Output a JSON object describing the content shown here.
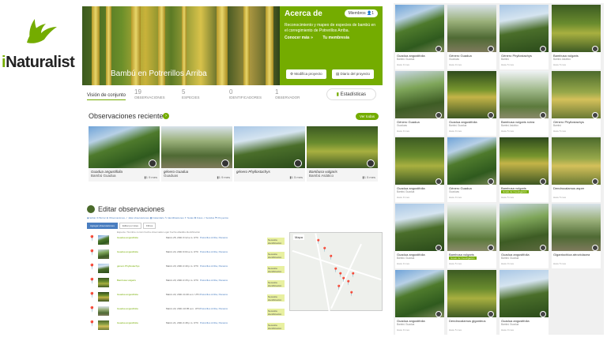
{
  "logo": {
    "text_i": "i",
    "text_rest": "Naturalist",
    "brand_color": "#74ac00"
  },
  "project": {
    "title": "Bambú en Potrerillos Arriba",
    "about_title": "Acerca de",
    "member_label": "Miembros",
    "member_count": "1",
    "description": "Reconocimiento y mapeo de especies de bambú en el corregimiento de Potrerillos Arriba.",
    "read_more": "Conocer más »",
    "membership": "Tu membresía",
    "modify_btn": "Modifica proyecto",
    "journal_btn": "Diario del proyecto"
  },
  "stats": {
    "tab": "Visión de conjunto",
    "observations_num": "19",
    "observations_lbl": "Observaciones",
    "species_num": "5",
    "species_lbl": "Especies",
    "identifiers_num": "0",
    "identifiers_lbl": "Identificadores",
    "observers_num": "1",
    "observers_lbl": "Observador",
    "stats_btn": "Estadísticas"
  },
  "recent": {
    "title": "Observaciones recientes",
    "view_all": "Ver todas",
    "cards": [
      {
        "name": "Guadua angustifolia",
        "common": "Bambú Guadua",
        "count": "1",
        "ago": "9 mes"
      },
      {
        "name": "género Guadua",
        "common": "Guaduas",
        "count": "1",
        "ago": "9 mes"
      },
      {
        "name": "género Phyllostachys",
        "common": "",
        "count": "1",
        "ago": "5 mes"
      },
      {
        "name": "Bambusa vulgaris",
        "common": "Bambú Asiático",
        "count": "1",
        "ago": "5 mes"
      }
    ]
  },
  "edit": {
    "title": "Editar observaciones",
    "toolbar": "◉ Editar   ⊘ Borrar   ⊕ Observaciones   ✓ Jalar observaciones   ▦ Calendario   ✎ Identificaciones   ✦ Notas   ✿ Fotos   ♫ Sonidos   ⚑ Proyectos",
    "filter_on": "Agregar observaciones",
    "filter_2": "Editar por lotes",
    "filter_3": "Filtros",
    "col_headers": "Especie / Nombre común          Fecha observada          Lugar                              Fecha añadida              Identificación",
    "map_label": "Mapa",
    "rows": [
      {
        "name": "Guadua angustifolia",
        "date": "Marzo 25, 2021 3:12 a.m. UTC",
        "loc": "Potrerillos Arriba, Panamá",
        "badge": "Necesita identificación"
      },
      {
        "name": "Guadua angustifolia",
        "date": "Marzo 24, 2021 9:04 a.m. UTC",
        "loc": "Potrerillos Arriba, Panamá",
        "badge": "Necesita identificación"
      },
      {
        "name": "género Phyllostachys",
        "date": "Marzo 23, 2021 2:40 p.m. UTC",
        "loc": "Potrerillos Arriba, Panamá",
        "badge": "Necesita identificación"
      },
      {
        "name": "Bambusa vulgaris",
        "date": "Marzo 23, 2021 2:15 p.m. UTC",
        "loc": "Potrerillos Arriba, Panamá",
        "badge": "Necesita identificación"
      },
      {
        "name": "Guadua angustifolia",
        "date": "Marzo 22, 2021 11:20 a.m. UTC",
        "loc": "Potrerillos Arriba, Panamá",
        "badge": "Necesita identificación"
      },
      {
        "name": "Guadua angustifolia",
        "date": "Marzo 22, 2021 10:05 a.m. UTC",
        "loc": "Potrerillos Arriba, Panamá",
        "badge": "Necesita identificación"
      },
      {
        "name": "Guadua angustifolia",
        "date": "Marzo 21, 2021 4:48 p.m. UTC",
        "loc": "Potrerillos Arriba, Panamá",
        "badge": "Necesita identificación"
      }
    ]
  },
  "grid": [
    {
      "name": "Guadua angustifolia",
      "sub": "Bambú Guadua",
      "meta": "Hace 9 mes"
    },
    {
      "name": "Género Guadua",
      "sub": "Guaduas",
      "meta": "Hace 9 mes"
    },
    {
      "name": "Género Phyllostachys",
      "sub": "Bambú",
      "meta": "Hace 5 mes"
    },
    {
      "name": "Bambusa vulgaris",
      "sub": "Bambú Asiático",
      "meta": "Hace 5 mes"
    },
    {
      "name": "Género Guadua",
      "sub": "Guaduas",
      "meta": "Hace 9 mes"
    },
    {
      "name": "Guadua angustifolia",
      "sub": "Bambú Guadua",
      "meta": "Hace 9 mes"
    },
    {
      "name": "Bambusa vulgaris rubra",
      "sub": "Bambú Asiático",
      "meta": "Hace 5 mes"
    },
    {
      "name": "Género Phyllostachys",
      "sub": "Bambú",
      "meta": "Hace 5 mes"
    },
    {
      "name": "Guadua angustifolia",
      "sub": "Bambú Guadua",
      "meta": "Hace 9 mes"
    },
    {
      "name": "Género Guadua",
      "sub": "Guaduas",
      "meta": "Hace 9 mes"
    },
    {
      "name": "Bambusa vulgaris",
      "sub": "Grado de investigación",
      "meta": "Hace 5 mes"
    },
    {
      "name": "Dendrocalamus asper",
      "sub": "",
      "meta": "Hace 5 mes"
    },
    {
      "name": "Guadua angustifolia",
      "sub": "Bambú Guadua",
      "meta": "Hace 9 mes"
    },
    {
      "name": "Bambusa vulgaris",
      "sub": "Grado de investigación",
      "meta": "Hace 5 mes"
    },
    {
      "name": "Guadua angustifolia",
      "sub": "Bambú Guadua",
      "meta": "Hace 9 mes"
    },
    {
      "name": "Gigantochloa atroviolacea",
      "sub": "",
      "meta": "Hace 5 mes"
    },
    {
      "name": "Guadua angustifolia",
      "sub": "Bambú Guadua",
      "meta": "Hace 9 mes"
    },
    {
      "name": "Dendrocalamus giganteus",
      "sub": "",
      "meta": "Hace 5 mes"
    },
    {
      "name": "Guadua angustifolia",
      "sub": "Bambú Guadua",
      "meta": "Hace 9 mes"
    }
  ]
}
